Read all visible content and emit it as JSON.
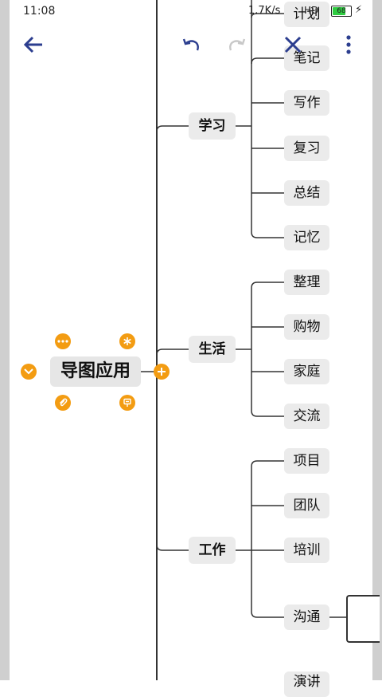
{
  "status_bar": {
    "time": "11:08",
    "net_speed": "1.7K/s",
    "signal_text": "HD",
    "battery": "68",
    "bolt": "⚡"
  },
  "toolbar": {
    "back_icon": "arrow-left-icon",
    "undo_icon": "undo-icon",
    "redo_icon": "redo-icon",
    "close_icon": "close-x-icon",
    "more_icon": "more-vertical-icon"
  },
  "mindmap": {
    "root": "导图应用",
    "branches": [
      {
        "label": "学习",
        "children": [
          "计划",
          "笔记",
          "写作",
          "复习",
          "总结",
          "记忆"
        ]
      },
      {
        "label": "生活",
        "children": [
          "整理",
          "购物",
          "家庭",
          "交流"
        ]
      },
      {
        "label": "工作",
        "children": [
          "项目",
          "团队",
          "培训",
          "沟通",
          "演讲"
        ]
      }
    ]
  },
  "colors": {
    "accent": "#2c3e8f",
    "orange": "#f39c12",
    "node_bg": "#ebebeb",
    "line": "#333333"
  }
}
